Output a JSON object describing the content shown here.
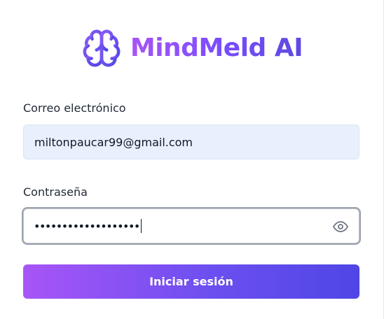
{
  "brand": {
    "name": "MindMeld AI",
    "icon": "brain-icon",
    "gradient_start": "#a855f7",
    "gradient_end": "#4f46e5"
  },
  "form": {
    "email": {
      "label": "Correo electrónico",
      "value": "miltonpaucar99@gmail.com"
    },
    "password": {
      "label": "Contraseña",
      "masked_value": "•••••••••••••••••••",
      "toggle_icon": "eye-icon"
    },
    "submit_label": "Iniciar sesión"
  }
}
